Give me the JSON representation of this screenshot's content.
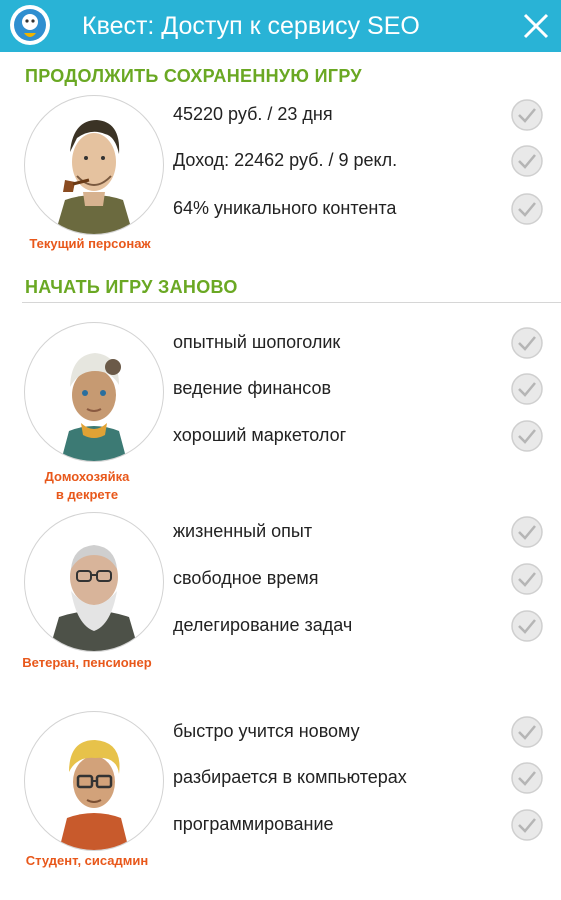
{
  "window": {
    "title": "Квест: Доступ к сервису SEO"
  },
  "icons": {
    "app": "app-avatar-icon",
    "close": "close-icon",
    "check": "check-circle-icon"
  },
  "colors": {
    "titlebar": "#29b3d6",
    "section_heading": "#6aa823",
    "character_label": "#e8581b"
  },
  "continue": {
    "heading": "ПРОДОЛЖИТЬ СОХРАНЕННУЮ ИГРУ",
    "character_label": "Текущий персонаж",
    "stats": [
      "45220 руб. / 23 дня",
      "Доход: 22462 руб. / 9 рекл.",
      "64% уникального контента"
    ]
  },
  "new_game": {
    "heading": "НАЧАТЬ ИГРУ ЗАНОВО",
    "characters": [
      {
        "label_lines": [
          "Домохозяйка",
          "в декрете"
        ],
        "traits": [
          "опытный шопоголик",
          "ведение финансов",
          "хороший маркетолог"
        ]
      },
      {
        "label_lines": [
          "Ветеран, пенсионер"
        ],
        "traits": [
          "жизненный опыт",
          "свободное время",
          "делегирование задач"
        ]
      },
      {
        "label_lines": [
          "Студент, сисадмин"
        ],
        "traits": [
          "быстро учится новому",
          "разбирается в компьютерах",
          "программирование"
        ]
      }
    ]
  }
}
